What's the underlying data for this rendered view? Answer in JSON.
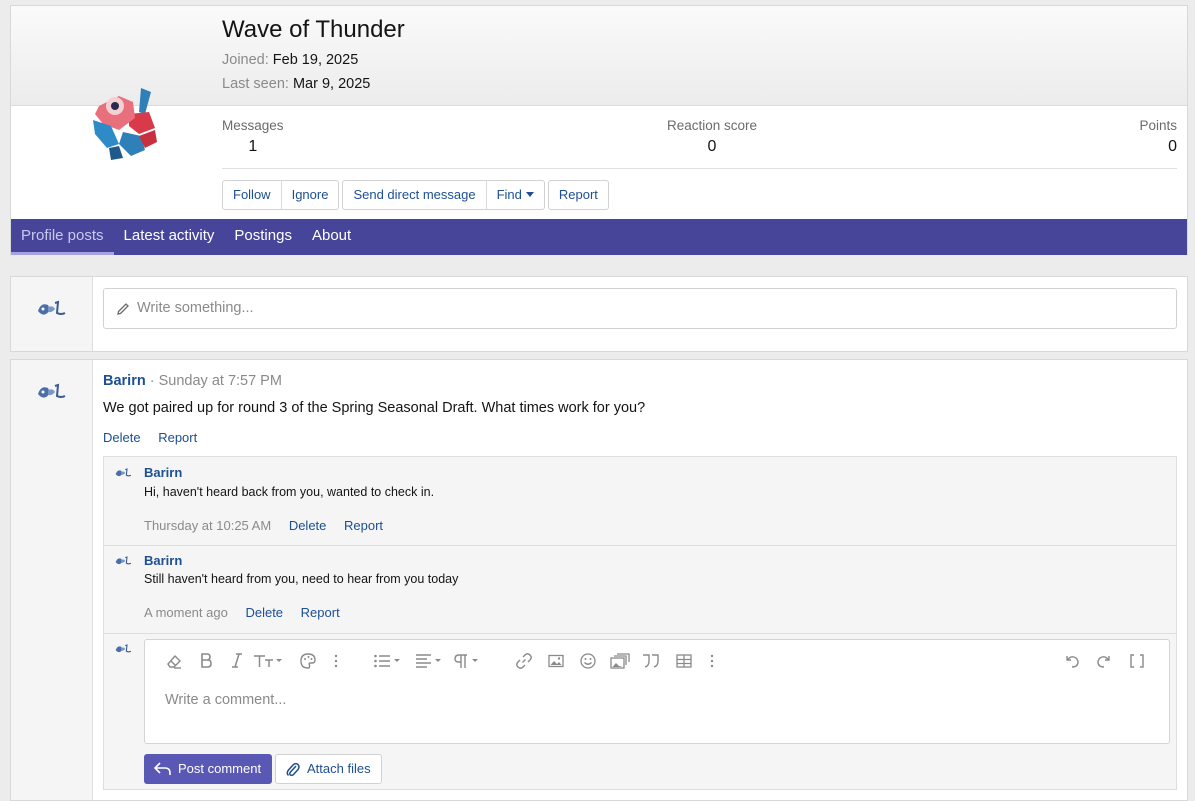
{
  "profile": {
    "name": "Wave of Thunder",
    "joined_label": "Joined:",
    "joined_value": "Feb 19, 2025",
    "last_seen_label": "Last seen:",
    "last_seen_value": "Mar 9, 2025",
    "stats": {
      "messages_label": "Messages",
      "messages_value": "1",
      "reaction_label": "Reaction score",
      "reaction_value": "0",
      "points_label": "Points",
      "points_value": "0"
    },
    "buttons": {
      "follow": "Follow",
      "ignore": "Ignore",
      "send_dm": "Send direct message",
      "find": "Find",
      "report": "Report"
    }
  },
  "tabs": [
    {
      "label": "Profile posts",
      "active": true
    },
    {
      "label": "Latest activity"
    },
    {
      "label": "Postings"
    },
    {
      "label": "About"
    }
  ],
  "compose": {
    "placeholder": "Write something..."
  },
  "post": {
    "author": "Barirn",
    "separator": " · ",
    "time": "Sunday at 7:57 PM",
    "body": "We got paired up for round 3 of the Spring Seasonal Draft. What times work for you?",
    "delete_label": "Delete",
    "report_label": "Report",
    "comments": [
      {
        "author": "Barirn",
        "text": "Hi, haven't heard back from you, wanted to check in.",
        "time": "Thursday at 10:25 AM",
        "delete_label": "Delete",
        "report_label": "Report"
      },
      {
        "author": "Barirn",
        "text": "Still haven't heard from you, need to hear from you today",
        "time": "A moment ago",
        "delete_label": "Delete",
        "report_label": "Report"
      }
    ],
    "editor": {
      "placeholder": "Write a comment...",
      "post_comment_label": "Post comment",
      "attach_files_label": "Attach files"
    }
  },
  "colors": {
    "accent": "#47459a",
    "button": "#5a58b5",
    "link": "#1d4f91"
  }
}
